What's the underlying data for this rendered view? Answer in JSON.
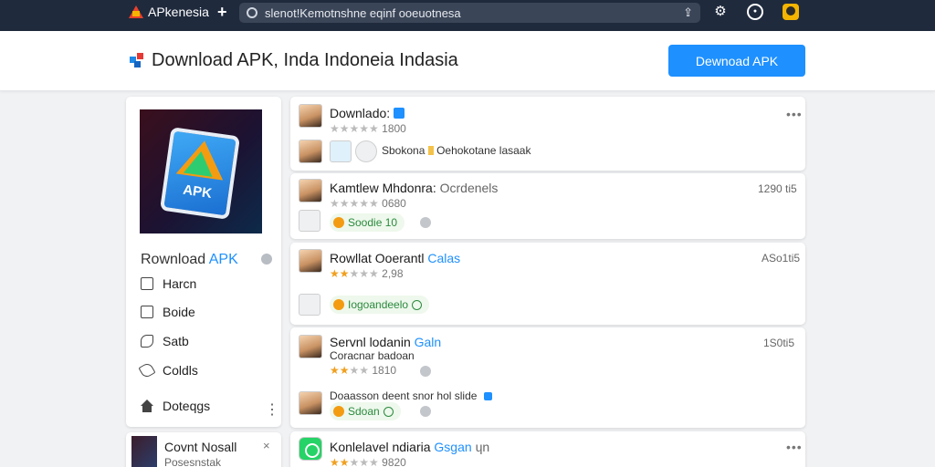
{
  "browser": {
    "brand": "APkenesia",
    "new_tab_label": "+",
    "url": "slenot!Kemotnshne eqinf ooeuotnesa"
  },
  "header": {
    "title": "Download APK, Inda Indoneia Indasia",
    "download_button": "Dewnoad APK"
  },
  "sidebar": {
    "app_title_prefix": "Rownload ",
    "app_title_accent": "APK",
    "app_image_label": "APK",
    "items": [
      {
        "label": "Harcn",
        "icon": "square-icon"
      },
      {
        "label": "Boide",
        "icon": "box-icon"
      },
      {
        "label": "Satb",
        "icon": "phone-icon"
      },
      {
        "label": "Coldls",
        "icon": "tag-icon"
      },
      {
        "label": "Doteqgs",
        "icon": "home-icon"
      }
    ],
    "more_label": "⋮"
  },
  "bottom_card": {
    "title": "Covnt Nosall",
    "subtitle": "Posesnstak",
    "close": "×"
  },
  "feed": [
    {
      "title": "Downlado:",
      "subtitle": "",
      "rating_on": "",
      "rating_off": "★★★★★",
      "rating_text": "1800",
      "time": "",
      "menu": "•••",
      "row_text": "Sbokona",
      "row_text2": "Oehokotane lasaak",
      "pill": ""
    },
    {
      "title": "Kamtlew Mhdonra:",
      "subtitle": "Ocrdenels",
      "rating_on": "",
      "rating_off": "★★★★★",
      "rating_text": "0680",
      "time": "1290 ti5",
      "menu": "",
      "row_text": "",
      "row_text2": "",
      "pill": "Soodie 10"
    },
    {
      "title": "Rowllat Ooerantl",
      "subtitle": "Calas",
      "rating_on": "★★",
      "rating_off": "★★★",
      "rating_text": "2,98",
      "time": "ASo1ti5",
      "menu": "",
      "row_text": "",
      "row_text2": "",
      "pill": "Iogoandeelo"
    },
    {
      "title": "Servnl lodanin",
      "subtitle": "Galn",
      "line2": "Coracnar badoan",
      "rating_on": "★★",
      "rating_off": "★★",
      "rating_text": "1810",
      "time": "1S0ti5",
      "menu": "",
      "row_text": "Doaasson deent snor hol slide",
      "row_text2": "",
      "pill": "Sdoan"
    },
    {
      "title": "Konlelavel ndiaria",
      "subtitle": "Gsgan",
      "rating_on": "★★",
      "rating_off": "★★★",
      "rating_text": "9820",
      "time": "",
      "menu": "•••",
      "extra": "ɥn"
    }
  ],
  "colors": {
    "accent": "#1e90ff",
    "topbar": "#1f2a3d",
    "pill_green": "#2b8a3e",
    "star": "#f0a020"
  }
}
